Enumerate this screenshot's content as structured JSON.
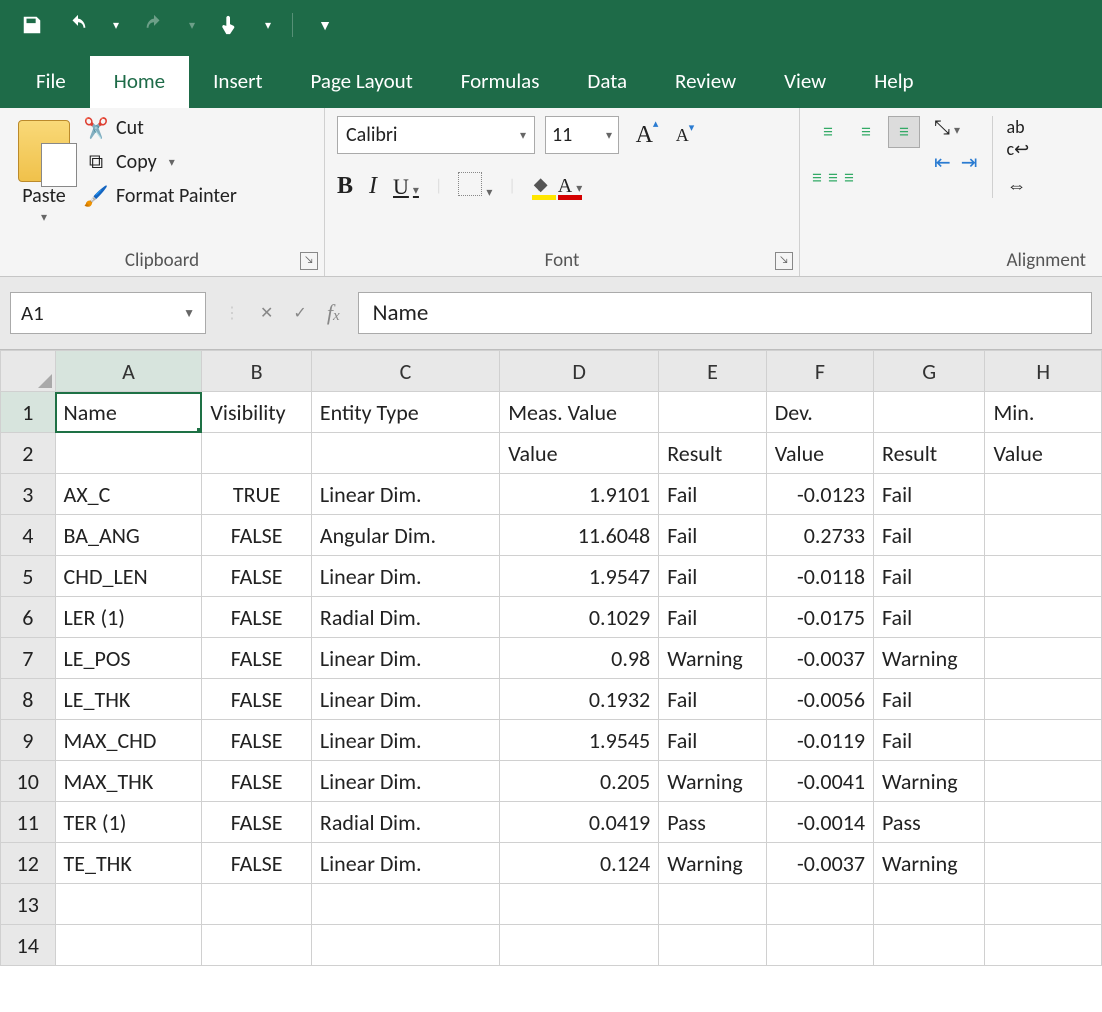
{
  "qat": {
    "save": "save-icon",
    "undo": "undo-icon",
    "redo": "redo-icon",
    "touch": "touch-mode-icon"
  },
  "tabs": [
    "File",
    "Home",
    "Insert",
    "Page Layout",
    "Formulas",
    "Data",
    "Review",
    "View",
    "Help"
  ],
  "active_tab": "Home",
  "ribbon": {
    "clipboard": {
      "label": "Clipboard",
      "paste": "Paste",
      "cut": "Cut",
      "copy": "Copy",
      "format_painter": "Format Painter"
    },
    "font": {
      "label": "Font",
      "name": "Calibri",
      "size": "11",
      "bold": "B",
      "italic": "I",
      "underline": "U",
      "grow": "A",
      "shrink": "A"
    },
    "alignment": {
      "label": "Alignment",
      "wrap": "ab\nc"
    }
  },
  "formula_bar": {
    "cell_ref": "A1",
    "value": "Name"
  },
  "columns": [
    "A",
    "B",
    "C",
    "D",
    "E",
    "F",
    "G",
    "H"
  ],
  "selected_cell": "A1",
  "rows": [
    {
      "n": 1,
      "A": "Name",
      "B": "Visibility",
      "C": "Entity Type",
      "D": "Meas. Value",
      "E": "",
      "F": "Dev.",
      "G": "",
      "H": "Min."
    },
    {
      "n": 2,
      "A": "",
      "B": "",
      "C": "",
      "D": "Value",
      "E": "Result",
      "F": "Value",
      "G": "Result",
      "H": "Value"
    },
    {
      "n": 3,
      "A": "AX_C",
      "B": "TRUE",
      "C": "Linear Dim.",
      "D": "1.9101",
      "E": "Fail",
      "F": "-0.0123",
      "G": "Fail",
      "H": ""
    },
    {
      "n": 4,
      "A": "BA_ANG",
      "B": "FALSE",
      "C": "Angular Dim.",
      "D": "11.6048",
      "E": "Fail",
      "F": "0.2733",
      "G": "Fail",
      "H": ""
    },
    {
      "n": 5,
      "A": "CHD_LEN",
      "B": "FALSE",
      "C": "Linear Dim.",
      "D": "1.9547",
      "E": "Fail",
      "F": "-0.0118",
      "G": "Fail",
      "H": ""
    },
    {
      "n": 6,
      "A": "LER (1)",
      "B": "FALSE",
      "C": "Radial Dim.",
      "D": "0.1029",
      "E": "Fail",
      "F": "-0.0175",
      "G": "Fail",
      "H": ""
    },
    {
      "n": 7,
      "A": "LE_POS",
      "B": "FALSE",
      "C": "Linear Dim.",
      "D": "0.98",
      "E": "Warning",
      "F": "-0.0037",
      "G": "Warning",
      "H": ""
    },
    {
      "n": 8,
      "A": "LE_THK",
      "B": "FALSE",
      "C": "Linear Dim.",
      "D": "0.1932",
      "E": "Fail",
      "F": "-0.0056",
      "G": "Fail",
      "H": ""
    },
    {
      "n": 9,
      "A": "MAX_CHD",
      "B": "FALSE",
      "C": "Linear Dim.",
      "D": "1.9545",
      "E": "Fail",
      "F": "-0.0119",
      "G": "Fail",
      "H": ""
    },
    {
      "n": 10,
      "A": "MAX_THK",
      "B": "FALSE",
      "C": "Linear Dim.",
      "D": "0.205",
      "E": "Warning",
      "F": "-0.0041",
      "G": "Warning",
      "H": ""
    },
    {
      "n": 11,
      "A": "TER (1)",
      "B": "FALSE",
      "C": "Radial Dim.",
      "D": "0.0419",
      "E": "Pass",
      "F": "-0.0014",
      "G": "Pass",
      "H": ""
    },
    {
      "n": 12,
      "A": "TE_THK",
      "B": "FALSE",
      "C": "Linear Dim.",
      "D": "0.124",
      "E": "Warning",
      "F": "-0.0037",
      "G": "Warning",
      "H": ""
    },
    {
      "n": 13,
      "A": "",
      "B": "",
      "C": "",
      "D": "",
      "E": "",
      "F": "",
      "G": "",
      "H": ""
    },
    {
      "n": 14,
      "A": "",
      "B": "",
      "C": "",
      "D": "",
      "E": "",
      "F": "",
      "G": "",
      "H": ""
    }
  ],
  "chart_data": {
    "type": "table",
    "title": "Spreadsheet cells",
    "headers_row1": [
      "Name",
      "Visibility",
      "Entity Type",
      "Meas. Value",
      "",
      "Dev.",
      "",
      "Min."
    ],
    "headers_row2": [
      "",
      "",
      "",
      "Value",
      "Result",
      "Value",
      "Result",
      "Value"
    ],
    "records": [
      {
        "Name": "AX_C",
        "Visibility": "TRUE",
        "Entity Type": "Linear Dim.",
        "Meas Value": 1.9101,
        "Meas Result": "Fail",
        "Dev Value": -0.0123,
        "Dev Result": "Fail"
      },
      {
        "Name": "BA_ANG",
        "Visibility": "FALSE",
        "Entity Type": "Angular Dim.",
        "Meas Value": 11.6048,
        "Meas Result": "Fail",
        "Dev Value": 0.2733,
        "Dev Result": "Fail"
      },
      {
        "Name": "CHD_LEN",
        "Visibility": "FALSE",
        "Entity Type": "Linear Dim.",
        "Meas Value": 1.9547,
        "Meas Result": "Fail",
        "Dev Value": -0.0118,
        "Dev Result": "Fail"
      },
      {
        "Name": "LER (1)",
        "Visibility": "FALSE",
        "Entity Type": "Radial Dim.",
        "Meas Value": 0.1029,
        "Meas Result": "Fail",
        "Dev Value": -0.0175,
        "Dev Result": "Fail"
      },
      {
        "Name": "LE_POS",
        "Visibility": "FALSE",
        "Entity Type": "Linear Dim.",
        "Meas Value": 0.98,
        "Meas Result": "Warning",
        "Dev Value": -0.0037,
        "Dev Result": "Warning"
      },
      {
        "Name": "LE_THK",
        "Visibility": "FALSE",
        "Entity Type": "Linear Dim.",
        "Meas Value": 0.1932,
        "Meas Result": "Fail",
        "Dev Value": -0.0056,
        "Dev Result": "Fail"
      },
      {
        "Name": "MAX_CHD",
        "Visibility": "FALSE",
        "Entity Type": "Linear Dim.",
        "Meas Value": 1.9545,
        "Meas Result": "Fail",
        "Dev Value": -0.0119,
        "Dev Result": "Fail"
      },
      {
        "Name": "MAX_THK",
        "Visibility": "FALSE",
        "Entity Type": "Linear Dim.",
        "Meas Value": 0.205,
        "Meas Result": "Warning",
        "Dev Value": -0.0041,
        "Dev Result": "Warning"
      },
      {
        "Name": "TER (1)",
        "Visibility": "FALSE",
        "Entity Type": "Radial Dim.",
        "Meas Value": 0.0419,
        "Meas Result": "Pass",
        "Dev Value": -0.0014,
        "Dev Result": "Pass"
      },
      {
        "Name": "TE_THK",
        "Visibility": "FALSE",
        "Entity Type": "Linear Dim.",
        "Meas Value": 0.124,
        "Meas Result": "Warning",
        "Dev Value": -0.0037,
        "Dev Result": "Warning"
      }
    ]
  }
}
